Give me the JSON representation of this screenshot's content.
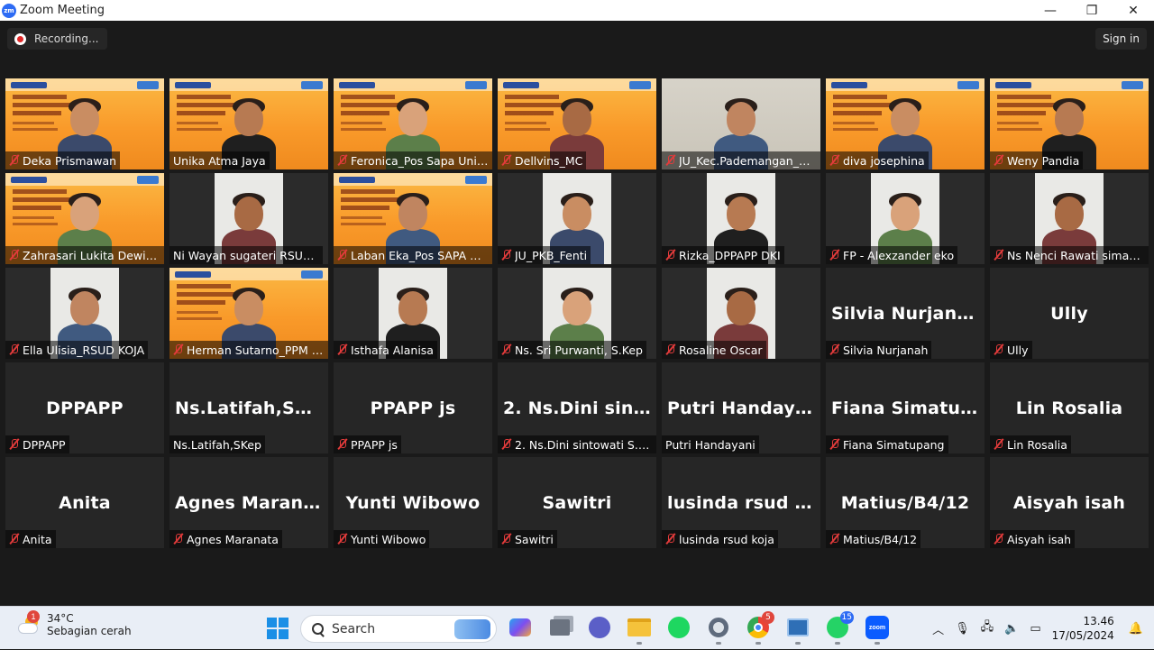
{
  "window": {
    "title": "Zoom Meeting",
    "logo": "zm",
    "minimize": "—",
    "maximize": "❐",
    "close": "✕"
  },
  "topbar": {
    "recording_label": "Recording...",
    "signin_label": "Sign in"
  },
  "participants": [
    {
      "name": "Deka Prismawan",
      "muted": true,
      "video": "slide"
    },
    {
      "name": "Unika Atma Jaya",
      "muted": false,
      "video": "slide",
      "active": true
    },
    {
      "name": "Feronica_Pos Sapa Unika ...",
      "muted": true,
      "video": "slide"
    },
    {
      "name": "Dellvins_MC",
      "muted": true,
      "video": "slide"
    },
    {
      "name": "JU_Kec.Pademangan_Kasi...",
      "muted": true,
      "video": "office"
    },
    {
      "name": "diva josephina",
      "muted": true,
      "video": "slide"
    },
    {
      "name": "Weny Pandia",
      "muted": true,
      "video": "slide"
    },
    {
      "name": "Zahrasari Lukita Dewi (Ay...",
      "muted": true,
      "video": "slide"
    },
    {
      "name": "Ni Wayan sugateri RSUD KOJA",
      "muted": false,
      "video": "room"
    },
    {
      "name": "Laban Eka_Pos SAPA UAJ",
      "muted": true,
      "video": "slide"
    },
    {
      "name": "JU_PKB_Fenti",
      "muted": true,
      "video": "room"
    },
    {
      "name": "Rizka_DPPAPP DKI",
      "muted": true,
      "video": "room"
    },
    {
      "name": "FP - Alexzander eko",
      "muted": true,
      "video": "room"
    },
    {
      "name": "Ns Nenci Rawati simanju...",
      "muted": true,
      "video": "room"
    },
    {
      "name": "Ella Ulisia_RSUD KOJA",
      "muted": true,
      "video": "room"
    },
    {
      "name": "Herman Sutarno_PPM Un...",
      "muted": true,
      "video": "slide"
    },
    {
      "name": "Isthafa Alanisa",
      "muted": true,
      "video": "room"
    },
    {
      "name": "Ns. Sri Purwanti, S.Kep",
      "muted": true,
      "video": "room"
    },
    {
      "name": "Rosaline Oscar",
      "muted": true,
      "video": "room"
    },
    {
      "name": "Silvia Nurjanah",
      "display": "Silvia Nurjanah",
      "muted": true,
      "video": "none"
    },
    {
      "name": "Ully",
      "display": "Ully",
      "muted": true,
      "video": "none"
    },
    {
      "name": "DPPAPP",
      "display": "DPPAPP",
      "muted": true,
      "video": "none"
    },
    {
      "name": "Ns.Latifah,SKep",
      "display": "Ns.Latifah,SKep",
      "muted": false,
      "video": "none"
    },
    {
      "name": "PPAPP js",
      "display": "PPAPP js",
      "muted": true,
      "video": "none"
    },
    {
      "name": "2. Ns.Dini sintowati S.kep...",
      "display": "2. Ns.Dini sinto...",
      "muted": true,
      "video": "none"
    },
    {
      "name": "Putri Handayani",
      "display": "Putri Handayani",
      "muted": false,
      "video": "none"
    },
    {
      "name": "Fiana Simatupang",
      "display": "Fiana Simatupa...",
      "muted": true,
      "video": "none"
    },
    {
      "name": "Lin Rosalia",
      "display": "Lin Rosalia",
      "muted": true,
      "video": "none"
    },
    {
      "name": "Anita",
      "display": "Anita",
      "muted": true,
      "video": "none"
    },
    {
      "name": "Agnes Maranata",
      "display": "Agnes Maranata",
      "muted": true,
      "video": "none"
    },
    {
      "name": "Yunti Wibowo",
      "display": "Yunti Wibowo",
      "muted": true,
      "video": "none"
    },
    {
      "name": "Sawitri",
      "display": "Sawitri",
      "muted": true,
      "video": "none"
    },
    {
      "name": "lusinda rsud koja",
      "display": "lusinda rsud koja",
      "muted": true,
      "video": "none"
    },
    {
      "name": "Matius/B4/12",
      "display": "Matius/B4/12",
      "muted": true,
      "video": "none"
    },
    {
      "name": "Aisyah isah",
      "display": "Aisyah isah",
      "muted": true,
      "video": "none"
    }
  ],
  "taskbar": {
    "weather": {
      "temp": "34°C",
      "condition": "Sebagian cerah",
      "badge": "1"
    },
    "search_label": "Search",
    "apps": [
      {
        "icon": "copilot-icon",
        "badge": ""
      },
      {
        "icon": "task-view-icon",
        "badge": ""
      },
      {
        "icon": "meet-icon",
        "badge": ""
      },
      {
        "icon": "file-explorer-icon",
        "badge": ""
      },
      {
        "icon": "spotify-icon",
        "badge": ""
      },
      {
        "icon": "settings-icon",
        "badge": ""
      },
      {
        "icon": "chrome-icon",
        "badge": "5"
      },
      {
        "icon": "remote-desktop-icon",
        "badge": ""
      },
      {
        "icon": "whatsapp-icon",
        "badge": "15"
      },
      {
        "icon": "zoom-icon",
        "badge": ""
      }
    ],
    "time": "13.46",
    "date": "17/05/2024"
  }
}
